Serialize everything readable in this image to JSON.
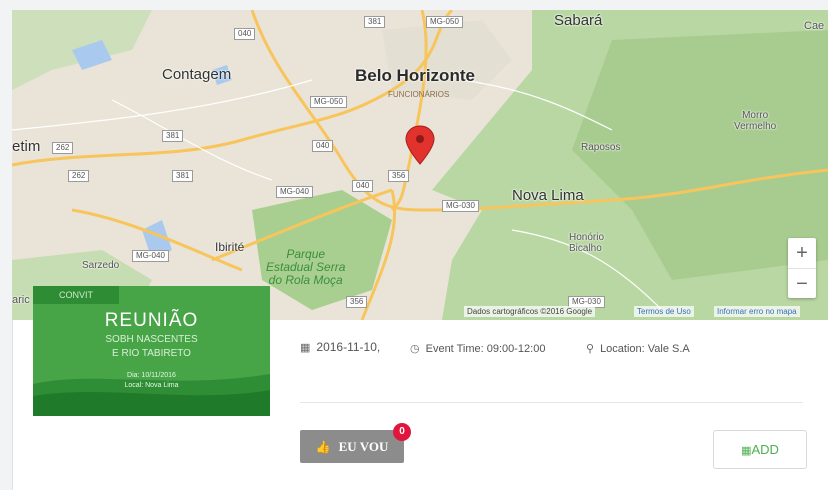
{
  "map": {
    "cities": {
      "belo_horizonte": "Belo Horizonte",
      "funcionarios": "FUNCIONÁRIOS",
      "contagem": "Contagem",
      "sabara": "Sabará",
      "cae": "Cae",
      "etim": "etim",
      "nova_lima": "Nova Lima",
      "raposos": "Raposos",
      "morro_vermelho": "Morro\nVermelho",
      "honorio_bicalho": "Honório\nBicalho",
      "ibirite": "Ibirité",
      "sarzedo": "Sarzedo",
      "park": "Parque\nEstadual Serra\ndo Rola Moça",
      "left_edge": "aric"
    },
    "shields": [
      "381",
      "MG-050",
      "040",
      "MG-050",
      "381",
      "262",
      "040",
      "262",
      "381",
      "MG-040",
      "040",
      "356",
      "MG-030",
      "MG-040",
      "356",
      "MG-030"
    ],
    "zoom_in": "+",
    "zoom_out": "−",
    "attribution": {
      "data": "Dados cartográficos ©2016 Google",
      "terms": "Termos de Uso",
      "report": "Informar erro no mapa"
    }
  },
  "event": {
    "thumbnail": {
      "tag": "CONVIT",
      "title": "REUNIÃO",
      "subtitle1": "SOBH NASCENTES",
      "subtitle2": "E RIO TABIRETO",
      "date": "Dia: 10/11/2016",
      "place": "Local: Nova Lima"
    },
    "date": "2016-11-10,",
    "time": "Event Time: 09:00-12:00",
    "location": "Location: Vale S.A",
    "going_label": "EU VOU",
    "going_count": "0",
    "add_label": "ADD"
  },
  "colors": {
    "pin": "#e2322d",
    "accent": "#4caf50",
    "badge": "#e0163d"
  }
}
